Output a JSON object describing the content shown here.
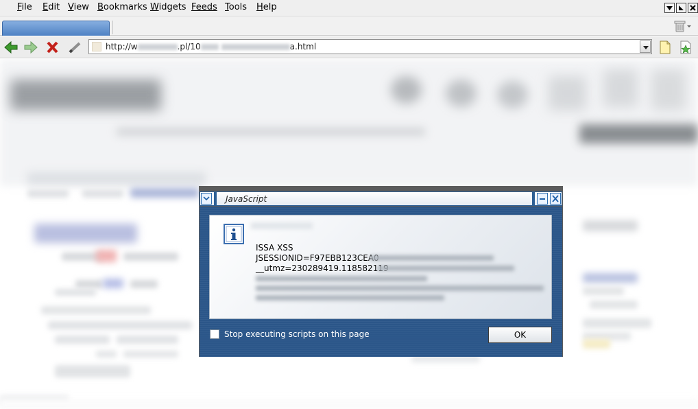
{
  "menubar": {
    "items": [
      {
        "label": "File",
        "mnemonic": "F",
        "rest": "ile"
      },
      {
        "label": "Edit",
        "mnemonic": "E",
        "rest": "dit"
      },
      {
        "label": "View",
        "mnemonic": "V",
        "rest": "iew"
      },
      {
        "label": "Bookmarks",
        "mnemonic": "B",
        "rest": "ookmarks"
      },
      {
        "label": "Widgets",
        "mnemonic": "W",
        "rest": "idgets"
      },
      {
        "label": "Feeds",
        "mnemonic": "",
        "rest": "Feeds"
      },
      {
        "label": "Tools",
        "mnemonic": "T",
        "rest": "ools"
      },
      {
        "label": "Help",
        "mnemonic": "H",
        "rest": "elp"
      }
    ]
  },
  "addressbar": {
    "url_prefix": "http://w",
    "url_mid1": ".pl/10",
    "url_suffix": "a.html"
  },
  "dialog": {
    "title": "JavaScript",
    "lines": [
      "ISSA XSS",
      "JSESSIONID=F97EBB123CEA0",
      "__utmz=230289419.118582119"
    ],
    "checkbox_label": "Stop executing scripts on this page",
    "ok_label": "OK"
  },
  "colors": {
    "dialog_blue": "#2b5689",
    "tab_active": "#4f82c4"
  }
}
